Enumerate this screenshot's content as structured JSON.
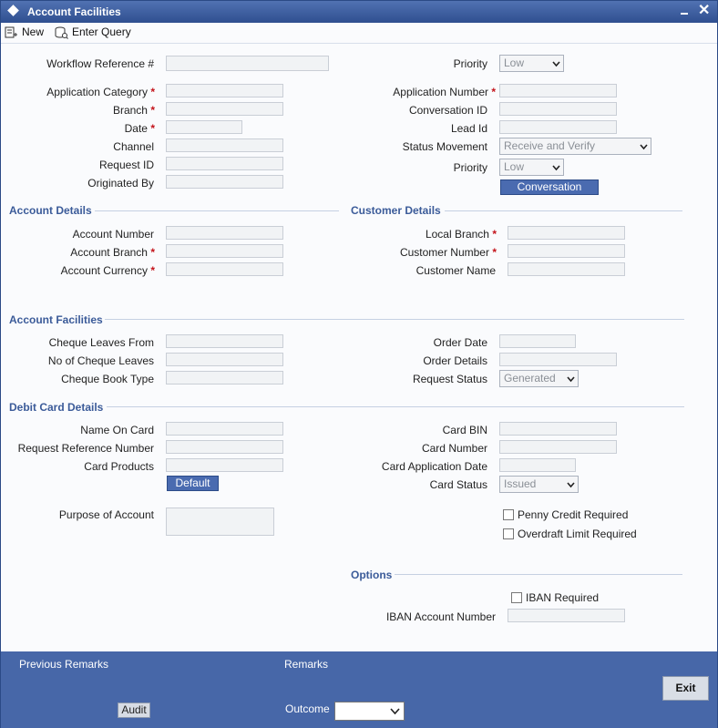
{
  "window": {
    "title": "Account Facilities"
  },
  "toolbar": {
    "new_label": "New",
    "enter_query_label": "Enter Query"
  },
  "header": {
    "workflow_reference": {
      "label": "Workflow Reference #",
      "value": ""
    },
    "priority_top": {
      "label": "Priority",
      "value": "Low"
    },
    "application_category": {
      "label": "Application Category",
      "value": ""
    },
    "branch": {
      "label": "Branch",
      "value": ""
    },
    "date": {
      "label": "Date",
      "value": ""
    },
    "channel": {
      "label": "Channel",
      "value": ""
    },
    "request_id": {
      "label": "Request ID",
      "value": ""
    },
    "originated_by": {
      "label": "Originated By",
      "value": ""
    },
    "application_number": {
      "label": "Application Number",
      "value": ""
    },
    "conversation_id": {
      "label": "Conversation ID",
      "value": ""
    },
    "lead_id": {
      "label": "Lead Id",
      "value": ""
    },
    "status_movement": {
      "label": "Status Movement",
      "value": "Receive and Verify"
    },
    "priority": {
      "label": "Priority",
      "value": "Low"
    },
    "conversation_button": "Conversation"
  },
  "account_details": {
    "title": "Account Details",
    "account_number": "Account Number",
    "account_branch": "Account Branch",
    "account_currency": "Account Currency"
  },
  "customer_details": {
    "title": "Customer Details",
    "local_branch": "Local Branch",
    "customer_number": "Customer Number",
    "customer_name": "Customer Name"
  },
  "account_facilities": {
    "title": "Account Facilities",
    "cheque_leaves_from": "Cheque Leaves From",
    "no_of_cheque_leaves": "No of Cheque Leaves",
    "cheque_book_type": "Cheque Book Type",
    "order_date": "Order Date",
    "order_details": "Order Details",
    "request_status": {
      "label": "Request Status",
      "value": "Generated"
    }
  },
  "debit_card": {
    "title": "Debit Card Details",
    "name_on_card": "Name On Card",
    "request_reference_number": "Request Reference Number",
    "card_products": "Card Products",
    "default_button": "Default",
    "card_bin": "Card BIN",
    "card_number": "Card Number",
    "card_application_date": "Card Application Date",
    "card_status": {
      "label": "Card Status",
      "value": "Issued"
    },
    "purpose_of_account": "Purpose of Account",
    "penny_credit_required": "Penny Credit Required",
    "overdraft_limit_required": "Overdraft Limit Required"
  },
  "options": {
    "title": "Options",
    "iban_required": "IBAN Required",
    "iban_account_number": "IBAN Account Number"
  },
  "footer": {
    "previous_remarks": "Previous Remarks",
    "remarks": "Remarks",
    "audit_button": "Audit",
    "outcome_label": "Outcome",
    "outcome_value": "",
    "exit_button": "Exit"
  },
  "colors": {
    "title_bar": "#3a5a9b",
    "section_title": "#3b5b99",
    "required": "#c4141b",
    "footer": "#4767a8"
  }
}
